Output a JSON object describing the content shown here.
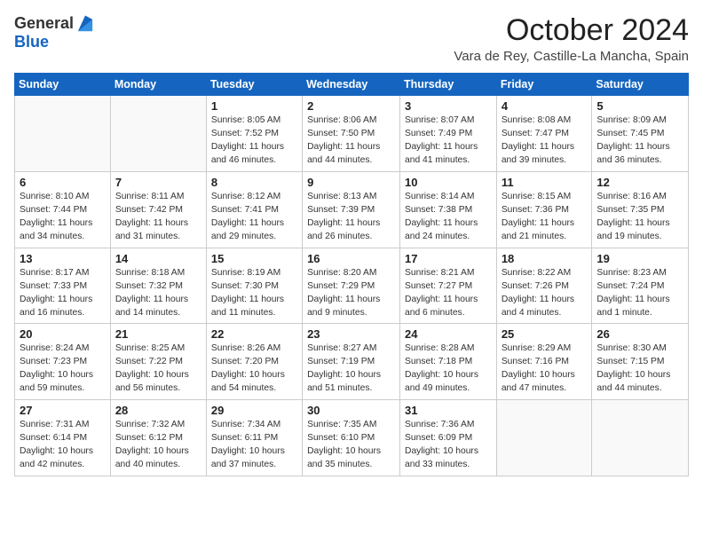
{
  "header": {
    "logo_general": "General",
    "logo_blue": "Blue",
    "month_title": "October 2024",
    "location": "Vara de Rey, Castille-La Mancha, Spain"
  },
  "weekdays": [
    "Sunday",
    "Monday",
    "Tuesday",
    "Wednesday",
    "Thursday",
    "Friday",
    "Saturday"
  ],
  "weeks": [
    [
      {
        "day": "",
        "info": ""
      },
      {
        "day": "",
        "info": ""
      },
      {
        "day": "1",
        "info": "Sunrise: 8:05 AM\nSunset: 7:52 PM\nDaylight: 11 hours and 46 minutes."
      },
      {
        "day": "2",
        "info": "Sunrise: 8:06 AM\nSunset: 7:50 PM\nDaylight: 11 hours and 44 minutes."
      },
      {
        "day": "3",
        "info": "Sunrise: 8:07 AM\nSunset: 7:49 PM\nDaylight: 11 hours and 41 minutes."
      },
      {
        "day": "4",
        "info": "Sunrise: 8:08 AM\nSunset: 7:47 PM\nDaylight: 11 hours and 39 minutes."
      },
      {
        "day": "5",
        "info": "Sunrise: 8:09 AM\nSunset: 7:45 PM\nDaylight: 11 hours and 36 minutes."
      }
    ],
    [
      {
        "day": "6",
        "info": "Sunrise: 8:10 AM\nSunset: 7:44 PM\nDaylight: 11 hours and 34 minutes."
      },
      {
        "day": "7",
        "info": "Sunrise: 8:11 AM\nSunset: 7:42 PM\nDaylight: 11 hours and 31 minutes."
      },
      {
        "day": "8",
        "info": "Sunrise: 8:12 AM\nSunset: 7:41 PM\nDaylight: 11 hours and 29 minutes."
      },
      {
        "day": "9",
        "info": "Sunrise: 8:13 AM\nSunset: 7:39 PM\nDaylight: 11 hours and 26 minutes."
      },
      {
        "day": "10",
        "info": "Sunrise: 8:14 AM\nSunset: 7:38 PM\nDaylight: 11 hours and 24 minutes."
      },
      {
        "day": "11",
        "info": "Sunrise: 8:15 AM\nSunset: 7:36 PM\nDaylight: 11 hours and 21 minutes."
      },
      {
        "day": "12",
        "info": "Sunrise: 8:16 AM\nSunset: 7:35 PM\nDaylight: 11 hours and 19 minutes."
      }
    ],
    [
      {
        "day": "13",
        "info": "Sunrise: 8:17 AM\nSunset: 7:33 PM\nDaylight: 11 hours and 16 minutes."
      },
      {
        "day": "14",
        "info": "Sunrise: 8:18 AM\nSunset: 7:32 PM\nDaylight: 11 hours and 14 minutes."
      },
      {
        "day": "15",
        "info": "Sunrise: 8:19 AM\nSunset: 7:30 PM\nDaylight: 11 hours and 11 minutes."
      },
      {
        "day": "16",
        "info": "Sunrise: 8:20 AM\nSunset: 7:29 PM\nDaylight: 11 hours and 9 minutes."
      },
      {
        "day": "17",
        "info": "Sunrise: 8:21 AM\nSunset: 7:27 PM\nDaylight: 11 hours and 6 minutes."
      },
      {
        "day": "18",
        "info": "Sunrise: 8:22 AM\nSunset: 7:26 PM\nDaylight: 11 hours and 4 minutes."
      },
      {
        "day": "19",
        "info": "Sunrise: 8:23 AM\nSunset: 7:24 PM\nDaylight: 11 hours and 1 minute."
      }
    ],
    [
      {
        "day": "20",
        "info": "Sunrise: 8:24 AM\nSunset: 7:23 PM\nDaylight: 10 hours and 59 minutes."
      },
      {
        "day": "21",
        "info": "Sunrise: 8:25 AM\nSunset: 7:22 PM\nDaylight: 10 hours and 56 minutes."
      },
      {
        "day": "22",
        "info": "Sunrise: 8:26 AM\nSunset: 7:20 PM\nDaylight: 10 hours and 54 minutes."
      },
      {
        "day": "23",
        "info": "Sunrise: 8:27 AM\nSunset: 7:19 PM\nDaylight: 10 hours and 51 minutes."
      },
      {
        "day": "24",
        "info": "Sunrise: 8:28 AM\nSunset: 7:18 PM\nDaylight: 10 hours and 49 minutes."
      },
      {
        "day": "25",
        "info": "Sunrise: 8:29 AM\nSunset: 7:16 PM\nDaylight: 10 hours and 47 minutes."
      },
      {
        "day": "26",
        "info": "Sunrise: 8:30 AM\nSunset: 7:15 PM\nDaylight: 10 hours and 44 minutes."
      }
    ],
    [
      {
        "day": "27",
        "info": "Sunrise: 7:31 AM\nSunset: 6:14 PM\nDaylight: 10 hours and 42 minutes."
      },
      {
        "day": "28",
        "info": "Sunrise: 7:32 AM\nSunset: 6:12 PM\nDaylight: 10 hours and 40 minutes."
      },
      {
        "day": "29",
        "info": "Sunrise: 7:34 AM\nSunset: 6:11 PM\nDaylight: 10 hours and 37 minutes."
      },
      {
        "day": "30",
        "info": "Sunrise: 7:35 AM\nSunset: 6:10 PM\nDaylight: 10 hours and 35 minutes."
      },
      {
        "day": "31",
        "info": "Sunrise: 7:36 AM\nSunset: 6:09 PM\nDaylight: 10 hours and 33 minutes."
      },
      {
        "day": "",
        "info": ""
      },
      {
        "day": "",
        "info": ""
      }
    ]
  ]
}
